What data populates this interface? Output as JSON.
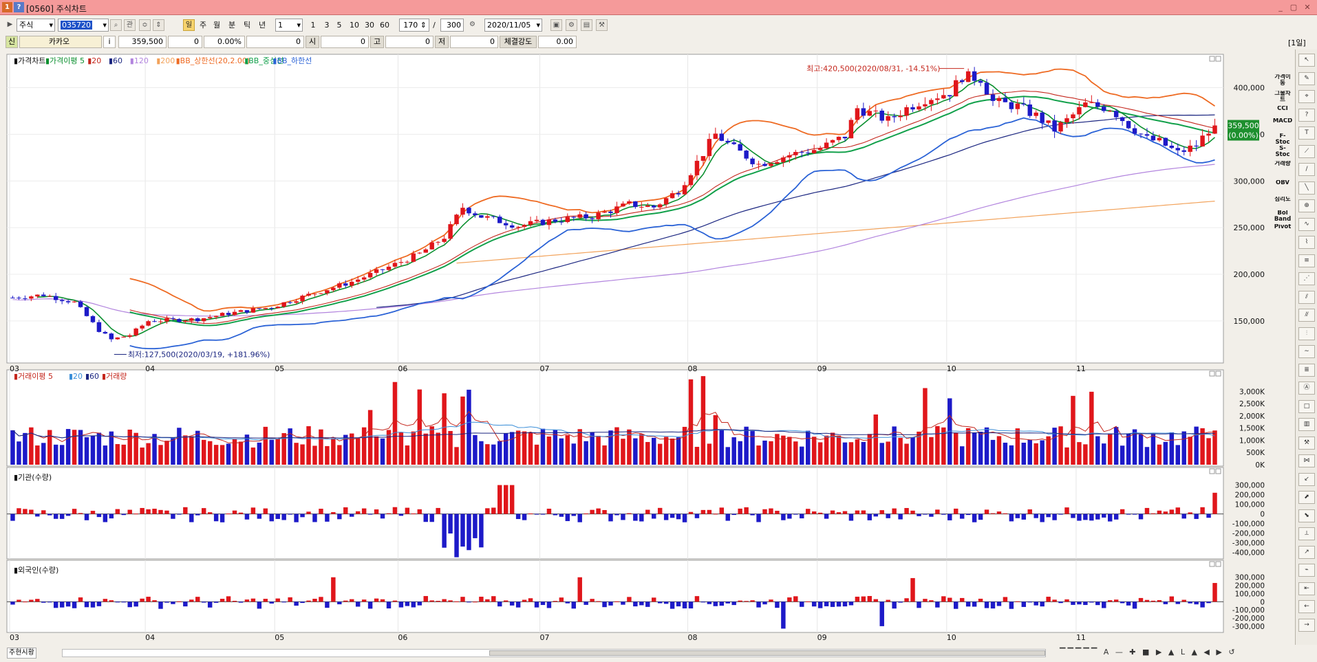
{
  "window": {
    "title": "[0560] 주식차트",
    "controls": [
      "_",
      "▢",
      "✕"
    ]
  },
  "toolbar": {
    "market": "주식",
    "code": "035720",
    "period_buttons": [
      "주",
      "월",
      "분",
      "틱",
      "년"
    ],
    "day_label": "일",
    "tick_input": "1",
    "interval_buttons": [
      "1",
      "3",
      "5",
      "10",
      "30",
      "60"
    ],
    "count": "170",
    "max_count": "300",
    "date": "2020/11/05",
    "related": "관"
  },
  "info": {
    "badge": "신",
    "name": "카카오",
    "i_label": "i",
    "price": "359,500",
    "change": "0",
    "rate": "0.00%",
    "volume": "0",
    "open_label": "시",
    "open": "0",
    "high_label": "고",
    "high": "0",
    "low_label": "저",
    "low": "0",
    "strength_label": "체결강도",
    "strength": "0.00",
    "period": "[1일]"
  },
  "main_chart": {
    "legend": {
      "title": "가격차트",
      "ma": "가격이평",
      "ma_periods": [
        "5",
        "20",
        "60",
        "120",
        "200"
      ],
      "bb_upper": "BB_상한선(20,2.00)",
      "bb_mid": "BB_중심선",
      "bb_lower": "BB_하한선"
    },
    "max_annotation": "최고:420,500(2020/08/31, -14.51%)",
    "min_annotation": "최저:127,500(2020/03/19, +181.96%)",
    "current_price": "359,500",
    "current_rate": "(0.00%)",
    "y_ticks": [
      "400,000",
      "350,000",
      "300,000",
      "250,000",
      "200,000",
      "150,000"
    ],
    "month_labels": [
      "03",
      "04",
      "05",
      "06",
      "07",
      "08",
      "09",
      "10",
      "11"
    ]
  },
  "volume_chart": {
    "legend": "거래이평",
    "periods": [
      "5",
      "20",
      "60"
    ],
    "label": "거래량",
    "y_ticks": [
      "3,000K",
      "2,500K",
      "2,000K",
      "1,500K",
      "1,000K",
      "500K",
      "0K"
    ]
  },
  "inst_chart": {
    "legend": "기관(수량)",
    "y_ticks": [
      "300,000",
      "200,000",
      "100,000",
      "0",
      "-100,000",
      "-200,000",
      "-300,000",
      "-400,000"
    ]
  },
  "foreign_chart": {
    "legend": "외국인(수량)",
    "y_ticks": [
      "300,000",
      "200,000",
      "100,000",
      "0",
      "-100,000",
      "-200,000",
      "-300,000"
    ]
  },
  "indicator_buttons": [
    "가격이동",
    "그물차트",
    "CCI",
    "MACD",
    "F-Stoc",
    "S-Stoc",
    "거래량",
    "OBV",
    "심리도",
    "Bol Band",
    "Pivot"
  ],
  "bottom_tabs": [
    "주",
    "현",
    "시",
    "황"
  ],
  "colors": {
    "up": "#e0161b",
    "down": "#1d1ac8",
    "ma5": "#0a8f2e",
    "ma20": "#c4261c",
    "ma60": "#1a2580",
    "ma120": "#b284de",
    "ma200": "#f2a25a",
    "bb_upper": "#ee6a22",
    "bb_mid": "#11a04a",
    "bb_lower": "#2a62d6"
  },
  "chart_data": {
    "type": "candlestick",
    "symbol": "카카오",
    "dates_start": "2020-03-02",
    "trading_days": 172,
    "ohlc": [],
    "price_high": 420500,
    "price_low": 127500,
    "last_close": 359500
  }
}
